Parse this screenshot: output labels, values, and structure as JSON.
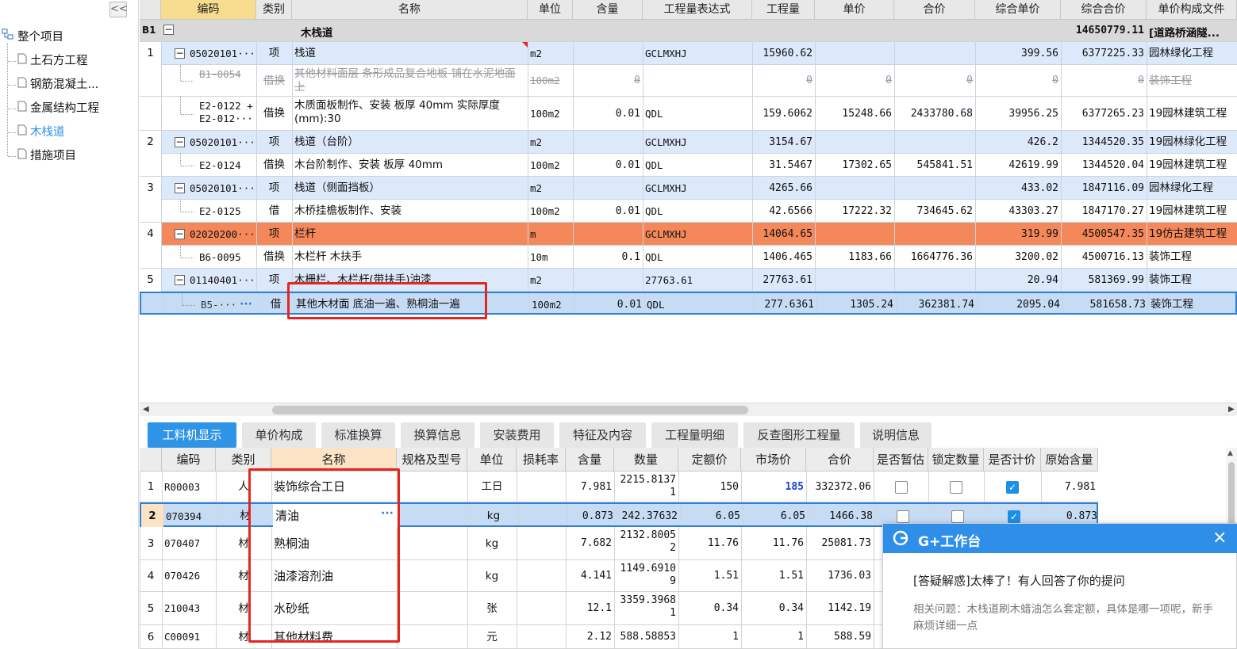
{
  "sidebar": {
    "collapse": "<<",
    "root": "整个项目",
    "items": [
      "土石方工程",
      "钢筋混凝土...",
      "金属结构工程",
      "木栈道",
      "措施项目"
    ]
  },
  "main": {
    "columns": [
      "编码",
      "类别",
      "名称",
      "单位",
      "含量",
      "工程量表达式",
      "工程量",
      "单价",
      "合价",
      "综合单价",
      "综合合价",
      "单价构成文件"
    ],
    "b1": {
      "code": "B1",
      "name": "木栈道",
      "total": "14650779.11",
      "file": "[道路桥涵隧..."
    },
    "rows": [
      {
        "idx": "1",
        "code": "05020101···",
        "type": "项",
        "name": "栈道",
        "unit": "m2",
        "qty": "",
        "expr": "GCLMXHJ",
        "amount": "15960.62",
        "price": "",
        "sum": "",
        "cprice": "399.56",
        "csum": "6377225.33",
        "file": "园林绿化工程",
        "kind": "item"
      },
      {
        "idx": "",
        "code": "B1-0054",
        "type": "借换",
        "name": "其他材料面层 条形成品复合地板 铺在水泥地面上",
        "unit": "100m2",
        "qty": "0",
        "expr": "",
        "amount": "0",
        "price": "0",
        "sum": "0",
        "cprice": "0",
        "csum": "0",
        "file": "装饰工程",
        "kind": "strike"
      },
      {
        "idx": "",
        "code": "E2-0122 + E2-012···",
        "type": "借换",
        "name": "木质面板制作、安装 板厚 40mm 实际厚度(mm):30",
        "unit": "100m2",
        "qty": "0.01",
        "expr": "QDL",
        "amount": "159.6062",
        "price": "15248.66",
        "sum": "2433780.68",
        "cprice": "39956.25",
        "csum": "6377265.23",
        "file": "19园林建筑工程",
        "kind": "sub"
      },
      {
        "idx": "2",
        "code": "05020101···",
        "type": "项",
        "name": "栈道（台阶）",
        "unit": "m2",
        "qty": "",
        "expr": "GCLMXHJ",
        "amount": "3154.67",
        "price": "",
        "sum": "",
        "cprice": "426.2",
        "csum": "1344520.35",
        "file": "19园林绿化工程",
        "kind": "item"
      },
      {
        "idx": "",
        "code": "E2-0124",
        "type": "借换",
        "name": "木台阶制作、安装 板厚 40mm",
        "unit": "100m2",
        "qty": "0.01",
        "expr": "QDL",
        "amount": "31.5467",
        "price": "17302.65",
        "sum": "545841.51",
        "cprice": "42619.99",
        "csum": "1344520.04",
        "file": "19园林建筑工程",
        "kind": "sub"
      },
      {
        "idx": "3",
        "code": "05020101···",
        "type": "项",
        "name": "栈道（侧面挡板）",
        "unit": "m2",
        "qty": "",
        "expr": "GCLMXHJ",
        "amount": "4265.66",
        "price": "",
        "sum": "",
        "cprice": "433.02",
        "csum": "1847116.09",
        "file": "园林绿化工程",
        "kind": "item"
      },
      {
        "idx": "",
        "code": "E2-0125",
        "type": "借",
        "name": "木桥挂檐板制作、安装",
        "unit": "100m2",
        "qty": "0.01",
        "expr": "QDL",
        "amount": "42.6566",
        "price": "17222.32",
        "sum": "734645.62",
        "cprice": "43303.27",
        "csum": "1847170.27",
        "file": "19园林建筑工程",
        "kind": "sub"
      },
      {
        "idx": "4",
        "code": "02020200···",
        "type": "项",
        "name": "栏杆",
        "unit": "m",
        "qty": "",
        "expr": "GCLMXHJ",
        "amount": "14064.65",
        "price": "",
        "sum": "",
        "cprice": "319.99",
        "csum": "4500547.35",
        "file": "19仿古建筑工程",
        "kind": "orange"
      },
      {
        "idx": "",
        "code": "B6-0095",
        "type": "借换",
        "name": "木栏杆 木扶手",
        "unit": "10m",
        "qty": "0.1",
        "expr": "QDL",
        "amount": "1406.465",
        "price": "1183.66",
        "sum": "1664776.36",
        "cprice": "3200.02",
        "csum": "4500716.13",
        "file": "装饰工程",
        "kind": "sub"
      },
      {
        "idx": "5",
        "code": "01140401···",
        "type": "项",
        "name": "木栅栏、木栏杆(带扶手)油漆",
        "unit": "m2",
        "qty": "",
        "expr": "27763.61",
        "amount": "27763.61",
        "price": "",
        "sum": "",
        "cprice": "20.94",
        "csum": "581369.99",
        "file": "装饰工程",
        "kind": "item"
      },
      {
        "idx": "",
        "code": "B5-···",
        "type": "借",
        "name": "其他木材面 底油一遍、熟桐油一遍",
        "unit": "100m2",
        "qty": "0.01",
        "expr": "QDL",
        "amount": "277.6361",
        "price": "1305.24",
        "sum": "362381.74",
        "cprice": "2095.04",
        "csum": "581658.73",
        "file": "装饰工程",
        "kind": "selected"
      }
    ]
  },
  "tabs": [
    "工料机显示",
    "单价构成",
    "标准换算",
    "换算信息",
    "安装费用",
    "特征及内容",
    "工程量明细",
    "反查图形工程量",
    "说明信息"
  ],
  "sub": {
    "columns": [
      "编码",
      "类别",
      "名称",
      "规格及型号",
      "单位",
      "损耗率",
      "含量",
      "数量",
      "定额价",
      "市场价",
      "合价",
      "是否暂估",
      "锁定数量",
      "是否计价",
      "原始含量"
    ],
    "rows": [
      {
        "idx": "1",
        "code": "R00003",
        "type": "人",
        "name": "装饰综合工日",
        "spec": "",
        "unit": "工日",
        "loss": "",
        "qty": "7.981",
        "count": "2215.8137\n1",
        "base": "150",
        "market": "185",
        "sum": "332372.06",
        "est": false,
        "lock": false,
        "priced": true,
        "orig": "7.981"
      },
      {
        "idx": "2",
        "code": "070394",
        "type": "材",
        "name": "清油",
        "spec": "",
        "unit": "kg",
        "loss": "",
        "qty": "0.873",
        "count": "242.37632",
        "base": "6.05",
        "market": "6.05",
        "sum": "1466.38",
        "est": false,
        "lock": false,
        "priced": true,
        "orig": "0.873"
      },
      {
        "idx": "3",
        "code": "070407",
        "type": "材",
        "name": "熟桐油",
        "spec": "",
        "unit": "kg",
        "loss": "",
        "qty": "7.682",
        "count": "2132.8005\n2",
        "base": "11.76",
        "market": "11.76",
        "sum": "25081.73"
      },
      {
        "idx": "4",
        "code": "070426",
        "type": "材",
        "name": "油漆溶剂油",
        "spec": "",
        "unit": "kg",
        "loss": "",
        "qty": "4.141",
        "count": "1149.6910\n9",
        "base": "1.51",
        "market": "1.51",
        "sum": "1736.03"
      },
      {
        "idx": "5",
        "code": "210043",
        "type": "材",
        "name": "水砂纸",
        "spec": "",
        "unit": "张",
        "loss": "",
        "qty": "12.1",
        "count": "3359.3968\n1",
        "base": "0.34",
        "market": "0.34",
        "sum": "1142.19"
      },
      {
        "idx": "6",
        "code": "C00091",
        "type": "材",
        "name": "其他材料费",
        "spec": "",
        "unit": "元",
        "loss": "",
        "qty": "2.12",
        "count": "588.58853",
        "base": "1",
        "market": "1",
        "sum": "588.59"
      }
    ]
  },
  "popup": {
    "title": "G+工作台",
    "close": "×",
    "headline": "[答疑解惑]太棒了！有人回答了你的提问",
    "detail": "相关问题：木栈道刷木蜡油怎么套定额，具体是哪一项呢，新手麻烦详细一点"
  },
  "colors": {
    "accent": "#2f93e6",
    "item_row": "#dce9fa",
    "orange_row": "#f4885a",
    "selected_row": "#c6dcf5",
    "highlight_box": "#e42620"
  }
}
